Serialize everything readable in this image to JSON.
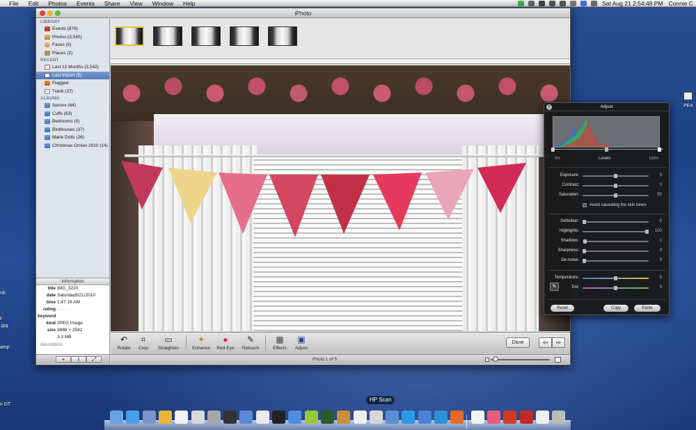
{
  "menubar": {
    "apple": "",
    "items": [
      "File",
      "Edit",
      "Photos",
      "Events",
      "Share",
      "View",
      "Window",
      "Help"
    ],
    "clock": "Sat Aug 21   2:54:48 PM",
    "user": "Connie C"
  },
  "desktop": {
    "labels": [
      "nb",
      "t-",
      ".jpg",
      "amp",
      "n DT",
      "PE4"
    ]
  },
  "window": {
    "title": "iPhoto"
  },
  "sidebar": {
    "library_header": "LIBRARY",
    "library": [
      {
        "label": "Events (876)",
        "icon": "events-icon"
      },
      {
        "label": "Photos (3,545)",
        "icon": "photos-icon"
      },
      {
        "label": "Faces (0)",
        "icon": "faces-icon"
      },
      {
        "label": "Places (2)",
        "icon": "places-icon"
      }
    ],
    "recent_header": "RECENT",
    "recent": [
      {
        "label": "Last 12 Months (3,542)",
        "icon": "calendar-icon"
      },
      {
        "label": "Last Import (5)",
        "icon": "import-icon",
        "selected": true
      },
      {
        "label": "Flagged",
        "icon": "flag-icon"
      },
      {
        "label": "Trash (37)",
        "icon": "trash-icon"
      }
    ],
    "albums_header": "ALBUMS",
    "albums": [
      {
        "label": "Aprons (64)",
        "icon": "album-icon"
      },
      {
        "label": "Cuffs (63)",
        "icon": "album-icon"
      },
      {
        "label": "Bedrooms (5)",
        "icon": "album-icon"
      },
      {
        "label": "Birdhouses (37)",
        "icon": "album-icon"
      },
      {
        "label": "Marie Dolls (26)",
        "icon": "album-icon"
      },
      {
        "label": "Christmas Ornies 2010 (14)",
        "icon": "album-icon"
      }
    ]
  },
  "info": {
    "header": "Information",
    "rows": [
      {
        "key": "title",
        "value": "IMG_3220"
      },
      {
        "key": "date",
        "value": "Saturday8/21/2010"
      },
      {
        "key": "time",
        "value": "1:47:16 AM"
      },
      {
        "key": "rating",
        "value": "· · · · ·"
      },
      {
        "key": "keyword",
        "value": ""
      },
      {
        "key": "kind",
        "value": "JPEG Image"
      },
      {
        "key": "size",
        "value": "3888 × 2592"
      },
      {
        "key": "",
        "value": "3.3 MB"
      }
    ],
    "description_placeholder": "description"
  },
  "bottom_bar": {
    "add_label": "+",
    "info_label": "i",
    "fullscreen_label": "⤢",
    "status": "Photo 1 of 5",
    "zoom_level": 0.03
  },
  "filmstrip": {
    "count": 5,
    "selected_index": 0
  },
  "toolbar": {
    "tools": [
      {
        "label": "Rotate",
        "icon": "rotate-icon",
        "glyph": "↶"
      },
      {
        "label": "Crop",
        "icon": "crop-icon",
        "glyph": "⌗"
      },
      {
        "label": "Straighten",
        "icon": "straighten-icon",
        "glyph": "▭"
      },
      {
        "label": "Enhance",
        "icon": "enhance-wand-icon",
        "glyph": "✦"
      },
      {
        "label": "Red-Eye",
        "icon": "red-eye-icon",
        "glyph": "●"
      },
      {
        "label": "Retouch",
        "icon": "retouch-brush-icon",
        "glyph": "✎"
      },
      {
        "label": "Effects",
        "icon": "effects-icon",
        "glyph": "▦"
      },
      {
        "label": "Adjust",
        "icon": "adjust-icon",
        "glyph": "▣"
      }
    ],
    "done_label": "Done",
    "prev_label": "⇦",
    "next_label": "⇨"
  },
  "adjust": {
    "title": "Adjust",
    "levels_label": "Levels",
    "levels_min": "0%",
    "levels_max": "100%",
    "group1": [
      {
        "label": "Exposure:",
        "value": "0",
        "pos": 0.5
      },
      {
        "label": "Contrast:",
        "value": "0",
        "pos": 0.5
      },
      {
        "label": "Saturation:",
        "value": "50",
        "pos": 0.5
      }
    ],
    "skin_tones_label": "Avoid saturating the skin tones",
    "group2": [
      {
        "label": "Definition:",
        "value": "0",
        "pos": 0.0
      },
      {
        "label": "Highlights:",
        "value": "100",
        "pos": 1.0
      },
      {
        "label": "Shadows:",
        "value": "1",
        "pos": 0.01
      },
      {
        "label": "Sharpness:",
        "value": "0",
        "pos": 0.0
      },
      {
        "label": "De-noise:",
        "value": "0",
        "pos": 0.0
      }
    ],
    "group3": [
      {
        "label": "Temperature:",
        "value": "0",
        "pos": 0.5
      },
      {
        "label": "Tint:",
        "value": "0",
        "pos": 0.5
      }
    ],
    "reset_label": "Reset",
    "copy_label": "Copy",
    "paste_label": "Paste"
  },
  "dock": {
    "tooltip": "HP Scan",
    "apps": [
      "finder-icon",
      "safari-icon",
      "preview-icon",
      "dollar-icon",
      "textedit-icon",
      "notes-icon",
      "mail-icon",
      "clock-icon",
      "bluetooth-icon",
      "ical-icon",
      "photo-booth-icon",
      "itunes-icon",
      "lime-icon",
      "timemachine-icon",
      "books-icon",
      "dashboard-icon",
      "news-icon",
      "iphoto-icon",
      "skype-icon",
      "upload-icon",
      "pse-icon",
      "firefox-icon",
      "document-icon",
      "stamp-icon",
      "starburst-icon",
      "truck-icon",
      "file-icon",
      "trash-icon"
    ]
  }
}
